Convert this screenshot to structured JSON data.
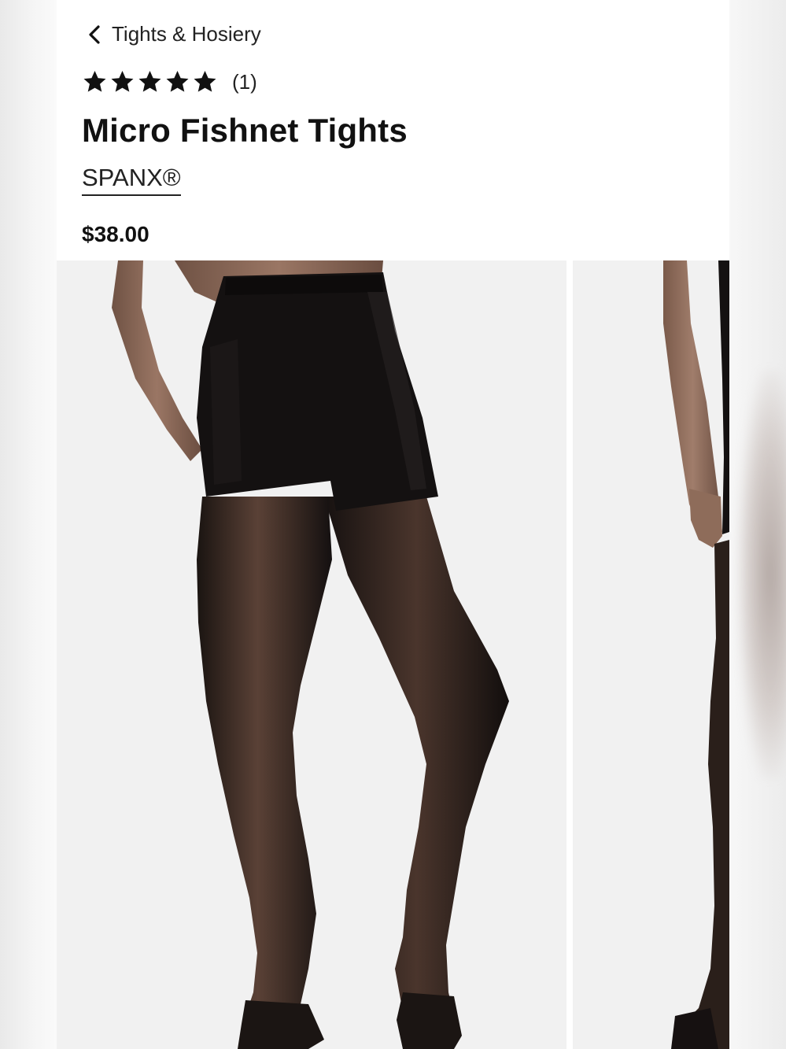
{
  "breadcrumb": {
    "label": "Tights & Hosiery",
    "icon": "chevron-left-icon"
  },
  "rating": {
    "stars": 5,
    "max_stars": 5,
    "review_count": "(1)"
  },
  "product": {
    "title": "Micro Fishnet Tights",
    "brand": "SPANX®",
    "price": "$38.00"
  },
  "gallery": {
    "image_count_visible": 2,
    "subject": "model wearing black micro fishnet tights"
  },
  "colors": {
    "page_bg": "#ffffff",
    "image_bg": "#f1f1f1",
    "text": "#111111",
    "product_black": "#111111",
    "skin": "#8a6a58"
  }
}
